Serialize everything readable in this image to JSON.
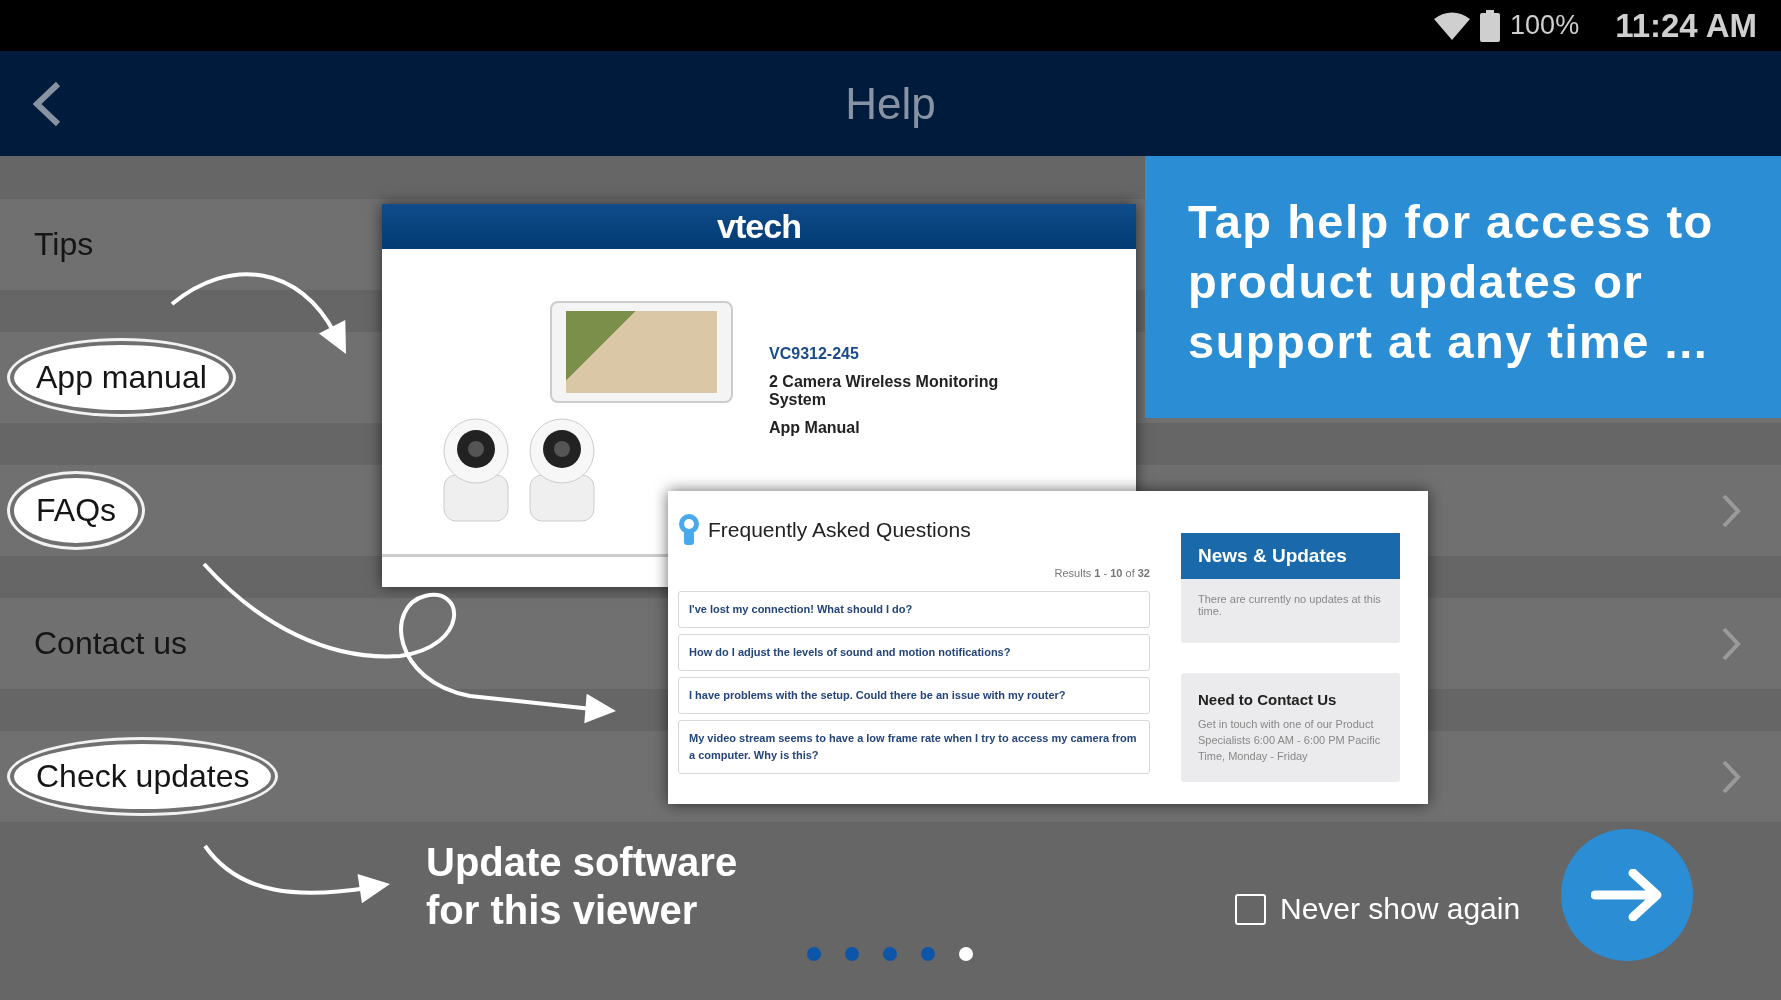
{
  "status_bar": {
    "battery": "100%",
    "time": "11:24 AM"
  },
  "app_bar": {
    "title": "Help"
  },
  "menu": [
    {
      "label": "Tips",
      "circled": false
    },
    {
      "label": "App manual",
      "circled": true
    },
    {
      "label": "FAQs",
      "circled": true
    },
    {
      "label": "Contact us",
      "circled": false
    },
    {
      "label": "Check updates",
      "circled": true
    }
  ],
  "manual_preview": {
    "brand": "vtech",
    "model": "VC9312-245",
    "product": "2 Camera Wireless Monitoring System",
    "document": "App Manual"
  },
  "faq_preview": {
    "title": "Frequently Asked Questions",
    "results": "Results **1** - **10** of **32**",
    "questions": [
      "I've lost my connection! What should I do?",
      "How do I adjust the levels of sound and motion notifications?",
      "I have problems with the setup. Could there be an issue with my router?",
      "My video stream seems to have a low frame rate when I try to access my camera from a computer. Why is this?"
    ],
    "news": {
      "title": "News & Updates",
      "body": "There are currently no updates at this time."
    },
    "contact": {
      "title": "Need to Contact Us",
      "body": "Get in touch with one of our Product Specialists 6:00 AM - 6:00 PM Pacific Time, Monday - Friday"
    }
  },
  "callout": "Tap help for access to product updates or support at any time ...",
  "caption": "Update software for this viewer",
  "never_show_again": {
    "label": "Never show again",
    "checked": false
  },
  "pager": [
    {
      "selected": false
    },
    {
      "selected": false
    },
    {
      "selected": false
    },
    {
      "selected": false
    },
    {
      "selected": true
    }
  ]
}
